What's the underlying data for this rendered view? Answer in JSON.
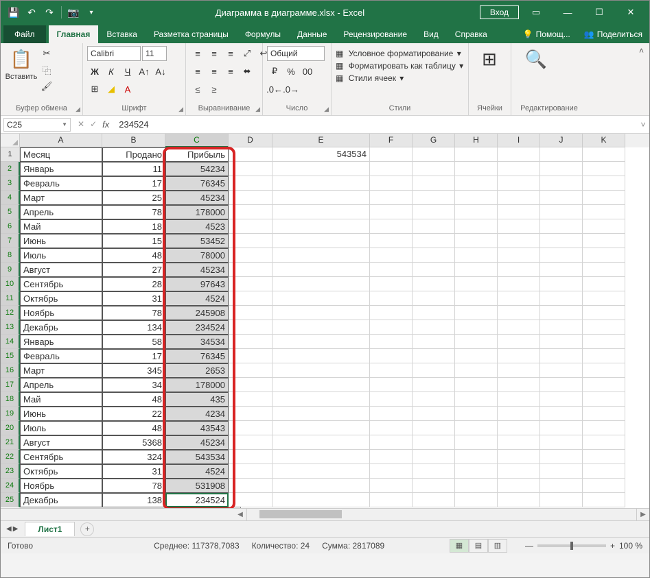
{
  "title": "Диаграмма в диаграмме.xlsx - Excel",
  "login": "Вход",
  "tabs": {
    "file": "Файл",
    "items": [
      "Главная",
      "Вставка",
      "Разметка страницы",
      "Формулы",
      "Данные",
      "Рецензирование",
      "Вид",
      "Справка"
    ],
    "right": {
      "tell": "Помощ...",
      "share": "Поделиться"
    }
  },
  "ribbon": {
    "clipboard": {
      "paste": "Вставить",
      "label": "Буфер обмена"
    },
    "font": {
      "name": "Calibri",
      "size": "11",
      "label": "Шрифт",
      "bold": "Ж",
      "italic": "К",
      "under": "Ч"
    },
    "align": {
      "label": "Выравнивание",
      "wrap": "↩"
    },
    "number": {
      "fmt": "Общий",
      "label": "Число"
    },
    "styles": {
      "cf": "Условное форматирование",
      "ft": "Форматировать как таблицу",
      "cs": "Стили ячеек",
      "label": "Стили"
    },
    "cells": {
      "label": "Ячейки"
    },
    "edit": {
      "label": "Редактирование"
    }
  },
  "namebox": "C25",
  "formula": "234524",
  "headers": [
    "A",
    "B",
    "C",
    "D",
    "E",
    "F",
    "G",
    "H",
    "I",
    "J",
    "K"
  ],
  "e1": "543534",
  "row1": {
    "a": "Месяц",
    "b": "Продано",
    "c": "Прибыль"
  },
  "data": [
    {
      "n": 2,
      "a": "Январь",
      "b": "11",
      "c": "54234"
    },
    {
      "n": 3,
      "a": "Февраль",
      "b": "17",
      "c": "76345"
    },
    {
      "n": 4,
      "a": "Март",
      "b": "25",
      "c": "45234"
    },
    {
      "n": 5,
      "a": "Апрель",
      "b": "78",
      "c": "178000"
    },
    {
      "n": 6,
      "a": "Май",
      "b": "18",
      "c": "4523"
    },
    {
      "n": 7,
      "a": "Июнь",
      "b": "15",
      "c": "53452"
    },
    {
      "n": 8,
      "a": "Июль",
      "b": "48",
      "c": "78000"
    },
    {
      "n": 9,
      "a": "Август",
      "b": "27",
      "c": "45234"
    },
    {
      "n": 10,
      "a": "Сентябрь",
      "b": "28",
      "c": "97643"
    },
    {
      "n": 11,
      "a": "Октябрь",
      "b": "31",
      "c": "4524"
    },
    {
      "n": 12,
      "a": "Ноябрь",
      "b": "78",
      "c": "245908"
    },
    {
      "n": 13,
      "a": "Декабрь",
      "b": "134",
      "c": "234524"
    },
    {
      "n": 14,
      "a": "Январь",
      "b": "58",
      "c": "34534"
    },
    {
      "n": 15,
      "a": "Февраль",
      "b": "17",
      "c": "76345"
    },
    {
      "n": 16,
      "a": "Март",
      "b": "345",
      "c": "2653"
    },
    {
      "n": 17,
      "a": "Апрель",
      "b": "34",
      "c": "178000"
    },
    {
      "n": 18,
      "a": "Май",
      "b": "48",
      "c": "435"
    },
    {
      "n": 19,
      "a": "Июнь",
      "b": "22",
      "c": "4234"
    },
    {
      "n": 20,
      "a": "Июль",
      "b": "48",
      "c": "43543"
    },
    {
      "n": 21,
      "a": "Август",
      "b": "5368",
      "c": "45234"
    },
    {
      "n": 22,
      "a": "Сентябрь",
      "b": "324",
      "c": "543534"
    },
    {
      "n": 23,
      "a": "Октябрь",
      "b": "31",
      "c": "4524"
    },
    {
      "n": 24,
      "a": "Ноябрь",
      "b": "78",
      "c": "531908"
    },
    {
      "n": 25,
      "a": "Декабрь",
      "b": "138",
      "c": "234524"
    }
  ],
  "sheet": "Лист1",
  "status": {
    "ready": "Готово",
    "avg": "Среднее: 117378,7083",
    "count": "Количество: 24",
    "sum": "Сумма: 2817089",
    "zoom": "100 %"
  }
}
